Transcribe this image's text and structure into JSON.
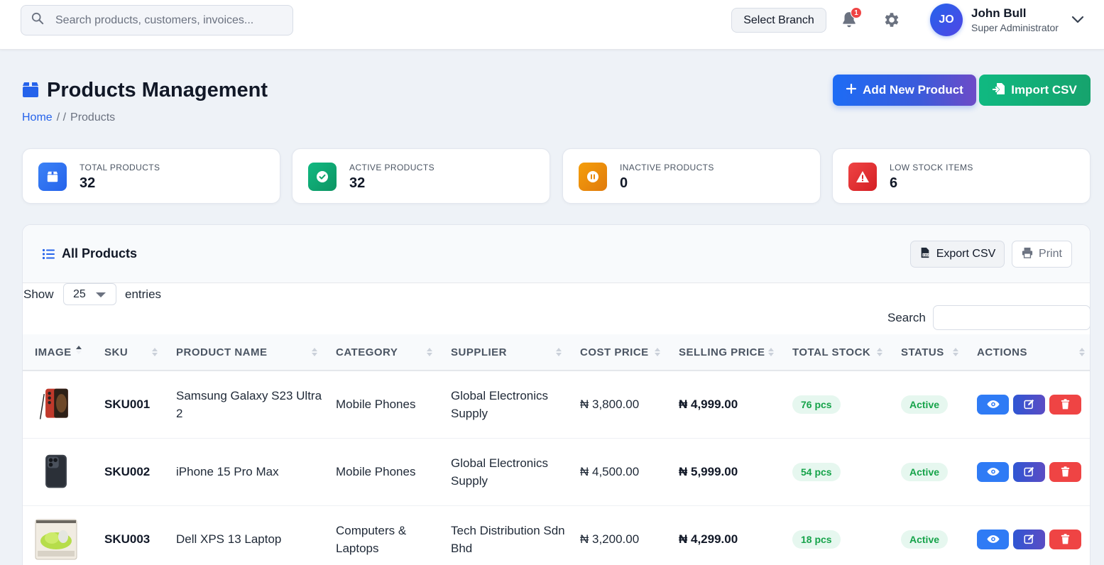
{
  "topbar": {
    "search_placeholder": "Search products, customers, invoices...",
    "branch_button": "Select Branch",
    "notification_count": "1",
    "user": {
      "initials": "JO",
      "name": "John Bull",
      "role": "Super Administrator"
    }
  },
  "page": {
    "title": "Products Management",
    "breadcrumb": {
      "home": "Home",
      "sep": "/ /",
      "current": "Products"
    },
    "add_button": "Add New Product",
    "import_button": "Import CSV"
  },
  "stats": [
    {
      "label": "TOTAL PRODUCTS",
      "value": "32",
      "color": "#2f6bf0",
      "icon": "box-icon"
    },
    {
      "label": "ACTIVE PRODUCTS",
      "value": "32",
      "color": "#10a36a",
      "icon": "check-circle-icon"
    },
    {
      "label": "INACTIVE PRODUCTS",
      "value": "0",
      "color": "#e88a0e",
      "icon": "pause-circle-icon"
    },
    {
      "label": "LOW STOCK ITEMS",
      "value": "6",
      "color": "#e0292e",
      "icon": "warning-icon"
    }
  ],
  "panel": {
    "title": "All Products",
    "export_button": "Export CSV",
    "print_button": "Print",
    "show_label": "Show",
    "page_size": "25",
    "entries_label": "entries",
    "search_label": "Search"
  },
  "table": {
    "columns": [
      "IMAGE",
      "SKU",
      "PRODUCT NAME",
      "CATEGORY",
      "SUPPLIER",
      "COST PRICE",
      "SELLING PRICE",
      "TOTAL STOCK",
      "STATUS",
      "ACTIONS"
    ],
    "rows": [
      {
        "sku": "SKU001",
        "name": "Samsung Galaxy S23 Ultra 2",
        "category": "Mobile Phones",
        "supplier": "Global Electronics Supply",
        "cost": "₦ 3,800.00",
        "selling": "₦ 4,999.00",
        "stock": "76 pcs",
        "status": "Active"
      },
      {
        "sku": "SKU002",
        "name": "iPhone 15 Pro Max",
        "category": "Mobile Phones",
        "supplier": "Global Electronics Supply",
        "cost": "₦ 4,500.00",
        "selling": "₦ 5,999.00",
        "stock": "54 pcs",
        "status": "Active"
      },
      {
        "sku": "SKU003",
        "name": "Dell XPS 13 Laptop",
        "category": "Computers & Laptops",
        "supplier": "Tech Distribution Sdn Bhd",
        "cost": "₦ 3,200.00",
        "selling": "₦ 4,299.00",
        "stock": "18 pcs",
        "status": "Active"
      }
    ]
  }
}
